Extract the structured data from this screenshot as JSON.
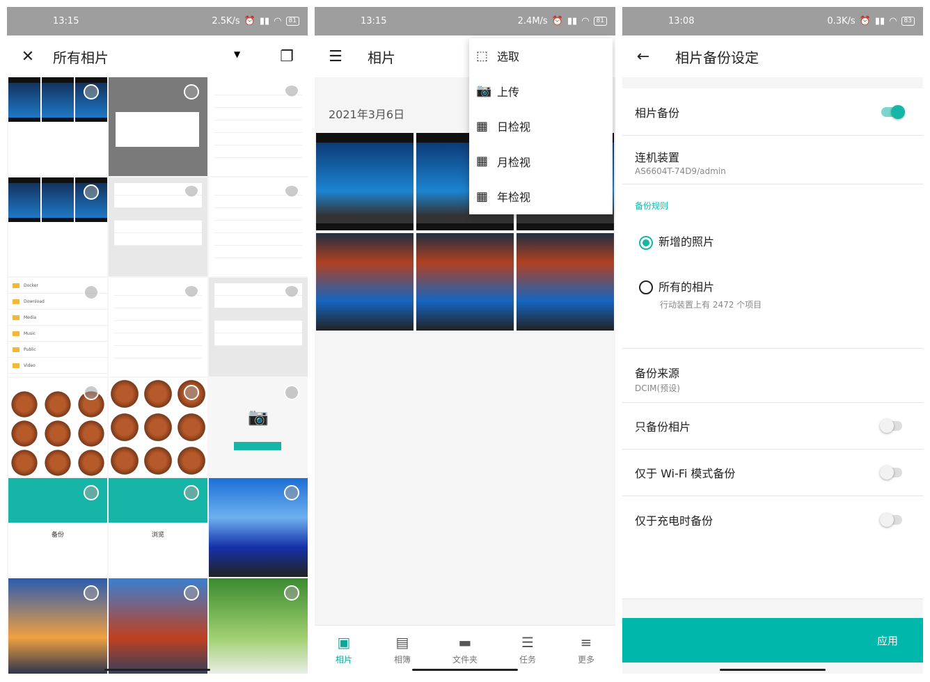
{
  "phone1": {
    "status": {
      "time": "13:15",
      "speed": "2.5K/s",
      "battery": "81"
    },
    "appbar": {
      "title": "所有相片",
      "close_icon": "close-icon",
      "dropdown_icon": "caret-down-icon",
      "select_icon": "copy-icon"
    },
    "folders": [
      "Docker",
      "Download",
      "Media",
      "Music",
      "Public",
      "Video"
    ],
    "tiles": {
      "backup_caption": "备份",
      "browse_caption": "浏览"
    }
  },
  "phone2": {
    "status": {
      "time": "13:15",
      "speed": "2.4M/s",
      "battery": "81"
    },
    "appbar": {
      "title": "相片",
      "menu_icon": "hamburger-icon"
    },
    "date_label": "2021年3月6日",
    "menu": [
      {
        "label": "选取",
        "icon": "select-icon"
      },
      {
        "label": "上传",
        "icon": "add-photo-icon"
      },
      {
        "label": "日检视",
        "icon": "grid-3-icon"
      },
      {
        "label": "月检视",
        "icon": "grid-4-icon"
      },
      {
        "label": "年检视",
        "icon": "grid-5-icon"
      }
    ],
    "nav": [
      {
        "label": "相片",
        "icon": "photo-icon",
        "active": true
      },
      {
        "label": "相簿",
        "icon": "album-icon",
        "active": false
      },
      {
        "label": "文件夹",
        "icon": "folder-icon",
        "active": false
      },
      {
        "label": "任务",
        "icon": "tasks-icon",
        "active": false
      },
      {
        "label": "更多",
        "icon": "more-icon",
        "active": false
      }
    ]
  },
  "phone3": {
    "status": {
      "time": "13:08",
      "speed": "0.3K/s",
      "battery": "83"
    },
    "appbar": {
      "title": "相片备份设定",
      "back_icon": "arrow-left-icon"
    },
    "photo_backup": {
      "label": "相片备份",
      "on": true
    },
    "device": {
      "label": "连机装置",
      "value": "AS6604T-74D9/admin"
    },
    "rules_label": "备份规则",
    "rule_new": {
      "label": "新增的照片",
      "selected": true
    },
    "rule_all": {
      "label": "所有的相片",
      "sub": "行动装置上有 2472 个项目",
      "selected": false
    },
    "source": {
      "label": "备份来源",
      "value": "DCIM(预设)"
    },
    "only_photos": {
      "label": "只备份相片",
      "on": false
    },
    "wifi_only": {
      "label": "仅于 Wi-Fi 模式备份",
      "on": false
    },
    "charging_only": {
      "label": "仅于充电时备份",
      "on": false
    },
    "apply_label": "应用",
    "accent": "#17b5a8"
  }
}
